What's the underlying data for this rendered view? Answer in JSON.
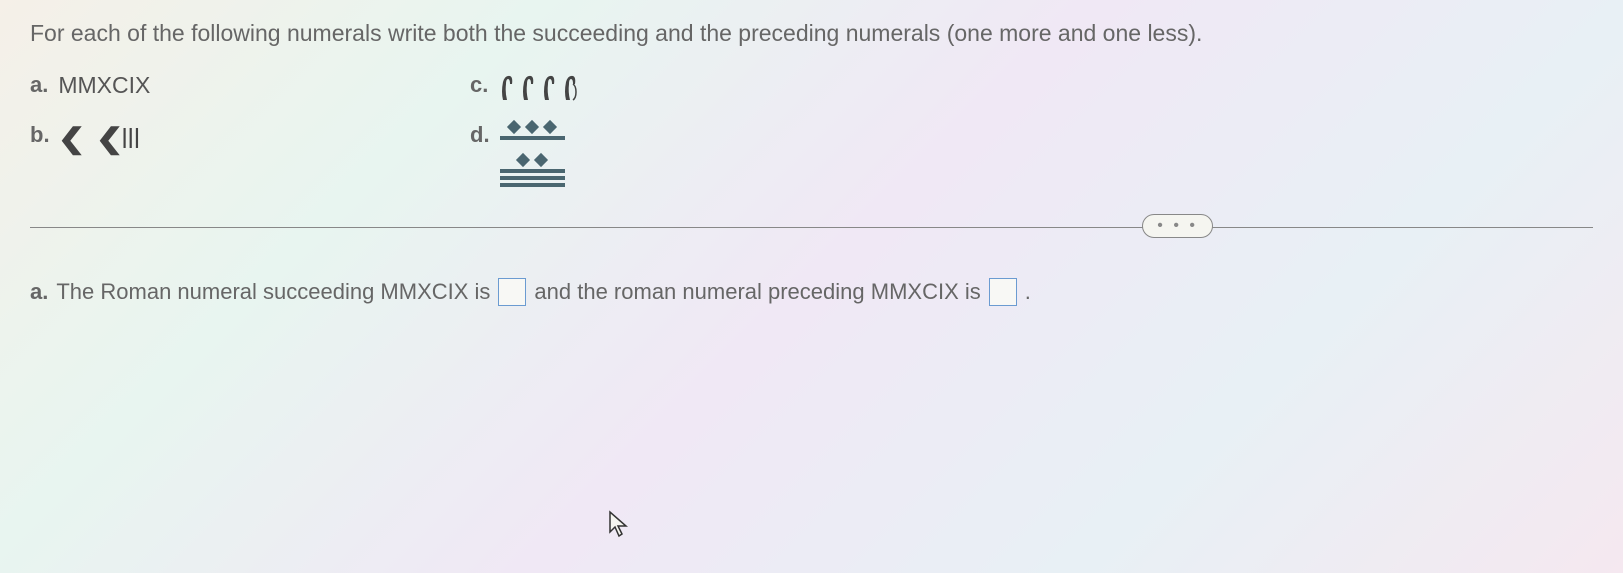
{
  "instruction": "For each of the following numerals write both the succeeding and the preceding numerals (one more and one less).",
  "problems": {
    "a": {
      "label": "a.",
      "content": "MMXCIX"
    },
    "b": {
      "label": "b.",
      "babylonian": {
        "tens_group1": 1,
        "tens_group2": 1,
        "ones": 3
      }
    },
    "c": {
      "label": "c.",
      "egyptian": {
        "heels": 4
      }
    },
    "d": {
      "label": "d.",
      "mayan": {
        "top": {
          "dots": 3,
          "bars": 1
        },
        "bottom": {
          "dots": 2,
          "bars": 3
        }
      }
    }
  },
  "divider": {
    "ellipsis": "• • •"
  },
  "answer": {
    "label": "a.",
    "text_part1": "The Roman numeral succeeding MMXCIX is",
    "text_part2": "and the roman numeral preceding MMXCIX is",
    "text_end": "."
  }
}
